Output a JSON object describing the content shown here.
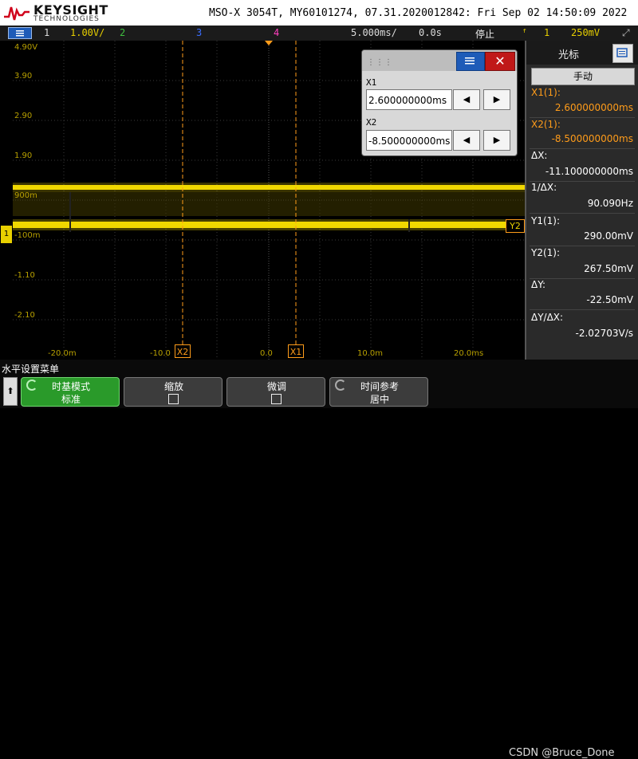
{
  "header": {
    "brand": "KEYSIGHT",
    "brand_sub": "TECHNOLOGIES",
    "title": "MSO-X 3054T, MY60101274, 07.31.2020012842: Fri Sep 02 14:50:09 2022"
  },
  "status_bar": {
    "ch1_num": "1",
    "ch1_scale": "1.00V/",
    "ch2_num": "2",
    "ch3_num": "3",
    "ch4_num": "4",
    "timebase": "5.000ms/",
    "delay": "0.0s",
    "run_state": "停止",
    "trigger_source": "1",
    "trigger_level": "250mV",
    "colors": {
      "ch1": "#e8d000",
      "ch2": "#3fbf3f",
      "ch3": "#3a6dff",
      "ch4": "#ff3fbf"
    }
  },
  "grid": {
    "y_labels": [
      "4.90V",
      "3.90",
      "2.90",
      "1.90",
      "900m",
      "-100m",
      "-1.10",
      "-2.10"
    ],
    "x_labels": [
      "-20.0m",
      "-10.0",
      "0.0",
      "10.0m",
      "20.0ms"
    ],
    "cursor_x2_label": "X2",
    "cursor_x1_label": "X1",
    "y2_marker": "Y2",
    "ground_marker": "1",
    "trace_color": "#f0d800",
    "cursor_color": "#ff9c1a"
  },
  "cursor_dialog": {
    "x1_label": "X1",
    "x1_value": "2.600000000ms",
    "x2_label": "X2",
    "x2_value": "-8.500000000ms",
    "close_glyph": "✕",
    "left_arrow": "◀",
    "right_arrow": "▶"
  },
  "right_panel": {
    "title": "光标",
    "mode": "手动",
    "rows": [
      {
        "label": "X1(1):",
        "value": "2.600000000ms",
        "color": "#ff9c1a"
      },
      {
        "label": "X2(1):",
        "value": "-8.500000000ms",
        "color": "#ff9c1a"
      },
      {
        "label": "ΔX:",
        "value": "-11.100000000ms",
        "color": "#ffffff"
      },
      {
        "label": "1/ΔX:",
        "value": "90.090Hz",
        "color": "#ffffff"
      },
      {
        "label": "Y1(1):",
        "value": "290.00mV",
        "color": "#ffffff"
      },
      {
        "label": "Y2(1):",
        "value": "267.50mV",
        "color": "#ffffff"
      },
      {
        "label": "ΔY:",
        "value": "-22.50mV",
        "color": "#ffffff"
      },
      {
        "label": "ΔY/ΔX:",
        "value": "-2.02703V/s",
        "color": "#ffffff"
      }
    ]
  },
  "softkeys": {
    "menu_title": "水平设置菜单",
    "back_glyph": "⬆",
    "keys": [
      {
        "top": "时基模式",
        "bottom": "标准"
      },
      {
        "top": "缩放",
        "bottom": ""
      },
      {
        "top": "微调",
        "bottom": ""
      },
      {
        "top": "时间参考",
        "bottom": "居中"
      }
    ]
  },
  "watermark": "CSDN @Bruce_Done"
}
